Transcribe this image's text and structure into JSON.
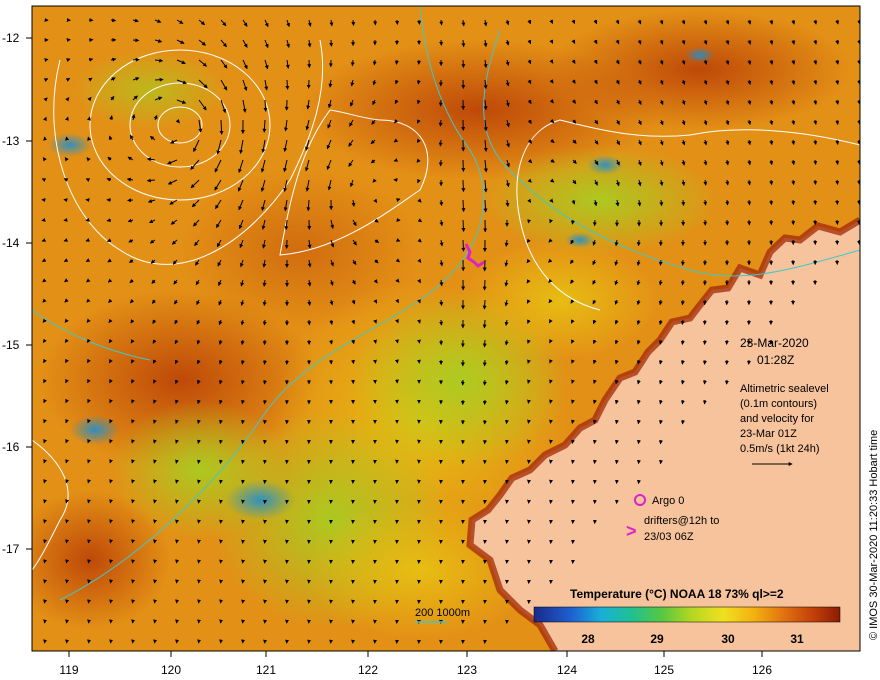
{
  "map": {
    "x_ticks": [
      "119",
      "120",
      "121",
      "122",
      "123",
      "124",
      "125",
      "126"
    ],
    "y_ticks": [
      "-12",
      "-13",
      "-14",
      "-15",
      "-16",
      "-17"
    ],
    "date": "23-Mar-2020",
    "time": "01:28Z",
    "altimetry_note": [
      "Altimetric sealevel",
      "(0.1m contours)",
      "and velocity for",
      "23-Mar 01Z",
      "0.5m/s (1kt 24h)"
    ],
    "argo_label": "Argo 0",
    "drifters_label": [
      "drifters@12h to",
      "23/03 06Z"
    ],
    "drifter_marker": ">",
    "bathy_label": "200  1000m",
    "colorbar_title": "Temperature (°C) NOAA 18 73% ql>=2",
    "colorbar_ticks": [
      "28",
      "29",
      "30",
      "31"
    ],
    "side_text": "© IMOS 30-Mar-2020 11:20:33 Hobart time"
  },
  "colors": {
    "land": "#f6c39c",
    "ocean_warm": "#d97a0e",
    "ocean_hot": "#b83c06",
    "ocean_mid": "#f0a80c",
    "ocean_green": "#a6cf22",
    "contour": "#ffffff",
    "bathy": "#40c8c8",
    "drifter": "#e020c8"
  }
}
